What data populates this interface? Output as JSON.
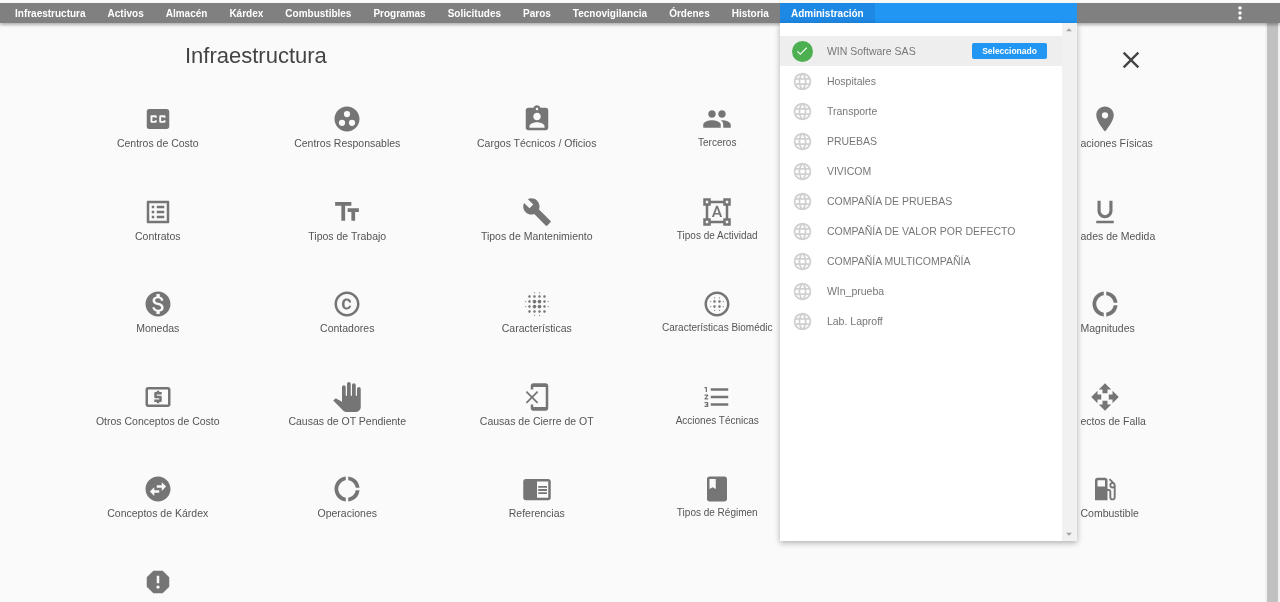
{
  "nav": {
    "items": [
      {
        "label": "Infraestructura",
        "selected": false
      },
      {
        "label": "Activos",
        "selected": false
      },
      {
        "label": "Almacén",
        "selected": false
      },
      {
        "label": "Kárdex",
        "selected": false
      },
      {
        "label": "Combustibles",
        "selected": false
      },
      {
        "label": "Programas",
        "selected": false
      },
      {
        "label": "Solicitudes",
        "selected": false
      },
      {
        "label": "Paros",
        "selected": false
      },
      {
        "label": "Tecnovigilancia",
        "selected": false
      },
      {
        "label": "Órdenes",
        "selected": false
      },
      {
        "label": "Historia",
        "selected": false
      },
      {
        "label": "Administración",
        "selected": true
      }
    ]
  },
  "company_menu": {
    "items": [
      {
        "label": "WIN Software SAS",
        "selected": true,
        "badge": "Seleccionado"
      },
      {
        "label": "Hospitales",
        "selected": false
      },
      {
        "label": "Transporte",
        "selected": false
      },
      {
        "label": "PRUEBAS",
        "selected": false
      },
      {
        "label": "VIVICOM",
        "selected": false
      },
      {
        "label": "COMPAÑÍA DE PRUEBAS",
        "selected": false
      },
      {
        "label": "COMPAÑÍA DE VALOR POR DEFECTO",
        "selected": false
      },
      {
        "label": "COMPAÑÍA MULTICOMPAÑÍA",
        "selected": false
      },
      {
        "label": "WIn_prueba",
        "selected": false
      },
      {
        "label": "Lab. Laproff",
        "selected": false
      }
    ]
  },
  "page": {
    "title": "Infraestructura",
    "rows": [
      [
        "Centros de Costo",
        "Centros Responsables",
        "Cargos Técnicos / Oficios",
        "Terceros",
        "aciones Físicas"
      ],
      [
        "Contratos",
        "Tipos de Trabajo",
        "Tipos de Mantenimiento",
        "Tipos de Actividad",
        "ades de Medida"
      ],
      [
        "Monedas",
        "Contadores",
        "Características",
        "Características Biomédic",
        "Magnitudes"
      ],
      [
        "Otros Conceptos de Costo",
        "Causas de OT Pendiente",
        "Causas de Cierre de OT",
        "Acciones Técnicas",
        "ectos de Falla"
      ],
      [
        "Conceptos de Kárdex",
        "Operaciones",
        "Referencias",
        "Tipos de Régimen",
        "Combustible"
      ]
    ]
  }
}
